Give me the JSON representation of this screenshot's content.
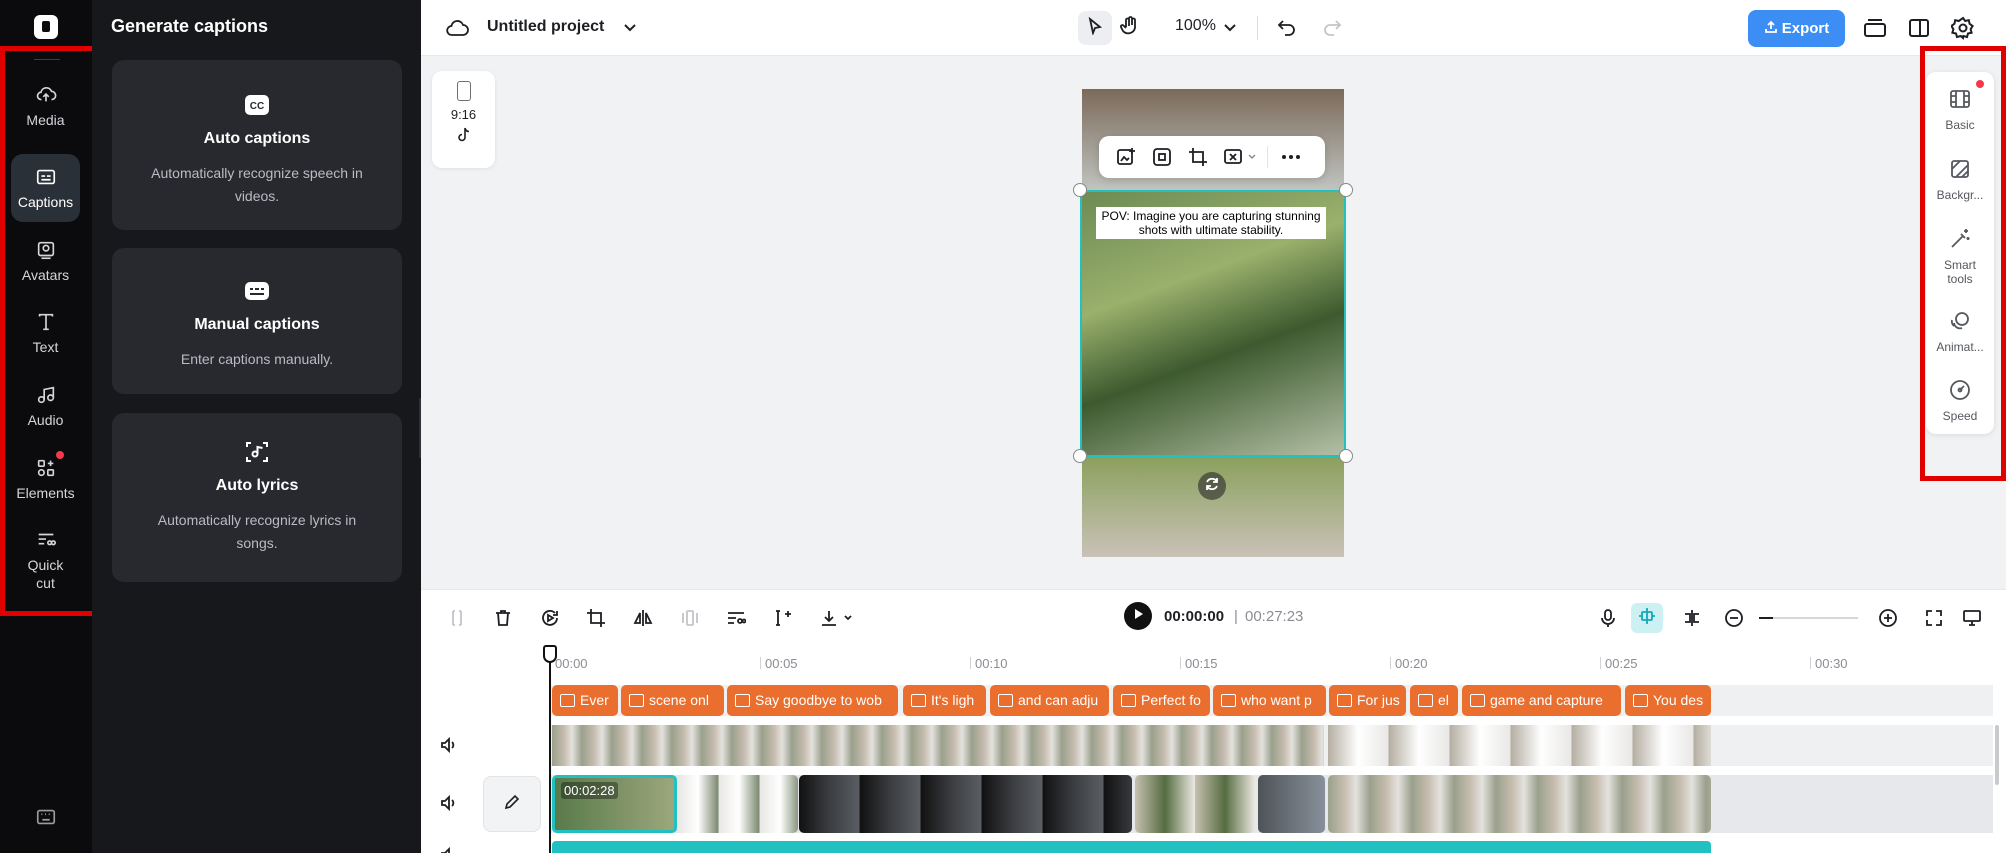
{
  "sidebar": {
    "items": [
      {
        "label": "Media",
        "icon": "cloud-upload-icon"
      },
      {
        "label": "Captions",
        "icon": "captions-icon"
      },
      {
        "label": "Avatars",
        "icon": "avatar-icon"
      },
      {
        "label": "Text",
        "icon": "text-icon"
      },
      {
        "label": "Audio",
        "icon": "music-note-icon"
      },
      {
        "label": "Elements",
        "icon": "elements-icon"
      },
      {
        "label": "Quick cut",
        "icon": "quick-cut-icon"
      }
    ],
    "active": "Captions"
  },
  "panel": {
    "title": "Generate captions",
    "cards": [
      {
        "title": "Auto captions",
        "description": "Automatically recognize speech in videos.",
        "icon": "cc-icon"
      },
      {
        "title": "Manual captions",
        "description": "Enter captions manually.",
        "icon": "keyboard-icon"
      },
      {
        "title": "Auto lyrics",
        "description": "Automatically recognize lyrics in songs.",
        "icon": "lyrics-icon"
      }
    ]
  },
  "header": {
    "project_name": "Untitled project",
    "zoom": "100%",
    "export_label": "Export"
  },
  "canvas": {
    "aspect_ratio": "9:16",
    "caption_text": "POV: Imagine you are capturing stunning shots with ultimate stability."
  },
  "properties": {
    "items": [
      {
        "label": "Basic",
        "icon": "film-icon"
      },
      {
        "label": "Backgr...",
        "icon": "background-icon"
      },
      {
        "label": "Smart tools",
        "icon": "magic-wand-icon"
      },
      {
        "label": "Animat...",
        "icon": "animation-icon"
      },
      {
        "label": "Speed",
        "icon": "speedometer-icon"
      }
    ]
  },
  "playback": {
    "current_time": "00:00:00",
    "total_time": "00:27:23"
  },
  "timeline": {
    "ticks": [
      "00:00",
      "00:05",
      "00:10",
      "00:15",
      "00:20",
      "00:25",
      "00:30"
    ],
    "captions": [
      "Ever",
      "scene onl",
      "Say goodbye to wob",
      "It's ligh",
      "and can adju",
      "Perfect fo",
      "who want p",
      "For jus",
      "el",
      "game and capture",
      "You des"
    ],
    "clip_duration": "00:02:28"
  },
  "colors": {
    "accent": "#3c8ef4",
    "caption_chip": "#ea6e2d",
    "selection": "#21c1c1",
    "highlight_box": "#e00000"
  }
}
